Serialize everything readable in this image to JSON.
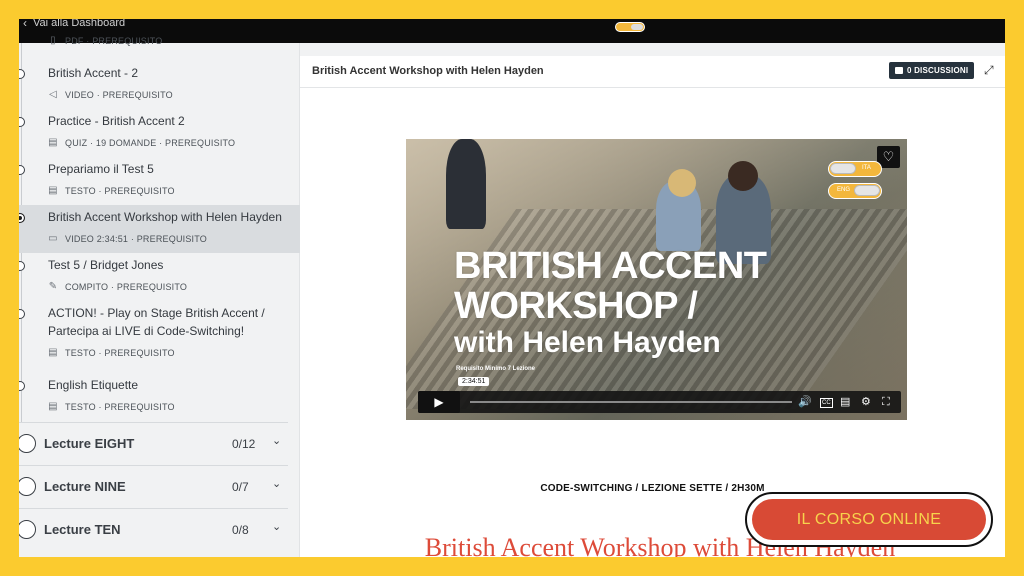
{
  "topbar": {
    "back_label": "Vai alla Dashboard"
  },
  "sidebar": {
    "partial_item": {
      "meta": "PDF · PREREQUISITO",
      "icon": "pdf-icon"
    },
    "lessons": [
      {
        "title": "British Accent - 2",
        "meta": "VIDEO · PREREQUISITO",
        "icon": "speaker-icon"
      },
      {
        "title": "Practice - British Accent 2",
        "meta": "QUIZ · 19 DOMANDE · PREREQUISITO",
        "icon": "quiz-icon"
      },
      {
        "title": "Prepariamo il Test 5",
        "meta": "TESTO · PREREQUISITO",
        "icon": "text-doc-icon"
      },
      {
        "title": "British Accent Workshop with Helen Hayden",
        "meta": "VIDEO 2:34:51 · PREREQUISITO",
        "icon": "video-camera-icon",
        "active": true
      },
      {
        "title": "Test 5 / Bridget Jones",
        "meta": "COMPITO · PREREQUISITO",
        "icon": "assignment-icon"
      },
      {
        "title_line1": "ACTION! - Play on Stage British Accent /",
        "title_line2": "Partecipa ai LIVE di Code-Switching!",
        "meta": "TESTO · PREREQUISITO",
        "icon": "text-doc-icon"
      },
      {
        "title": "English Etiquette",
        "meta": "TESTO · PREREQUISITO",
        "icon": "text-doc-icon"
      }
    ],
    "sections": [
      {
        "title": "Lecture EIGHT",
        "count": "0/12"
      },
      {
        "title": "Lecture NINE",
        "count": "0/7"
      },
      {
        "title": "Lecture TEN",
        "count": "0/8"
      }
    ]
  },
  "main": {
    "lesson_title": "British Accent Workshop with Helen Hayden",
    "discussions_label": "0 DISCUSSIONI",
    "video": {
      "title_line1": "BRITISH ACCENT",
      "title_line2": "WORKSHOP /",
      "title_line3": "with Helen Hayden",
      "subtitle": "Requisito Minimo 7 Lezione",
      "time_tooltip": "2:34:51",
      "toggle_top_label": "ITA",
      "toggle_bottom_label": "ENG",
      "progress": 0
    },
    "course_line": "CODE-SWITCHING / LEZIONE SETTE / 2H30M",
    "heading": "British Accent Workshop with Helen Hayden"
  },
  "cta": {
    "label": "IL CORSO ONLINE"
  },
  "colors": {
    "border_yellow": "#fbcb2f",
    "cta_red": "#d84a35",
    "cta_text": "#f7d34c",
    "heading_red": "#dd4b39",
    "discussion_button": "#26323d"
  }
}
